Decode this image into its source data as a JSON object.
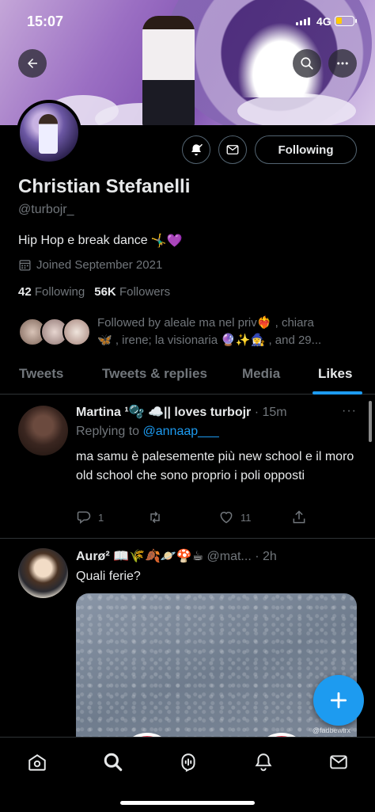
{
  "status_bar": {
    "time": "15:07",
    "network": "4G"
  },
  "profile": {
    "name": "Christian Stefanelli",
    "handle": "@turbojr_",
    "bio": "Hip Hop e break dance",
    "bio_emoji": "🤸‍♂️💜",
    "joined": "Joined September 2021",
    "following_count": "42",
    "following_label": "Following",
    "followers_count": "56K",
    "followers_label": "Followers",
    "followed_by_line1": "Followed by aleale ma nel priv❤️‍🔥 , chiara",
    "followed_by_line2": "🦋 , irene; la visionaria 🔮✨🧙‍♀️ , and 29...",
    "follow_button": "Following"
  },
  "tabs": [
    {
      "label": "Tweets"
    },
    {
      "label": "Tweets & replies"
    },
    {
      "label": "Media"
    },
    {
      "label": "Likes"
    }
  ],
  "active_tab": "Likes",
  "tweets": [
    {
      "author": "Martina ¹🫧 ☁️|| loves turbojr",
      "time": "· 15m",
      "replying_prefix": "Replying to",
      "replying_to": "@annaap___",
      "text": "ma samu è palesemente più new school e il moro old school che sono proprio i poli opposti",
      "replies": "1",
      "retweets": "",
      "likes": "11"
    },
    {
      "author": "Aurø² 📖🌾🍂🪐🍄☕",
      "handle": "@mat...",
      "time": "· 2h",
      "text": "Quali ferie?",
      "media_watermark": "@fadbewtrx"
    }
  ],
  "colors": {
    "accent": "#1d9bf0",
    "muted": "#71767b",
    "text": "#e7e9ea",
    "background": "#000000",
    "divider": "#2f3336"
  }
}
